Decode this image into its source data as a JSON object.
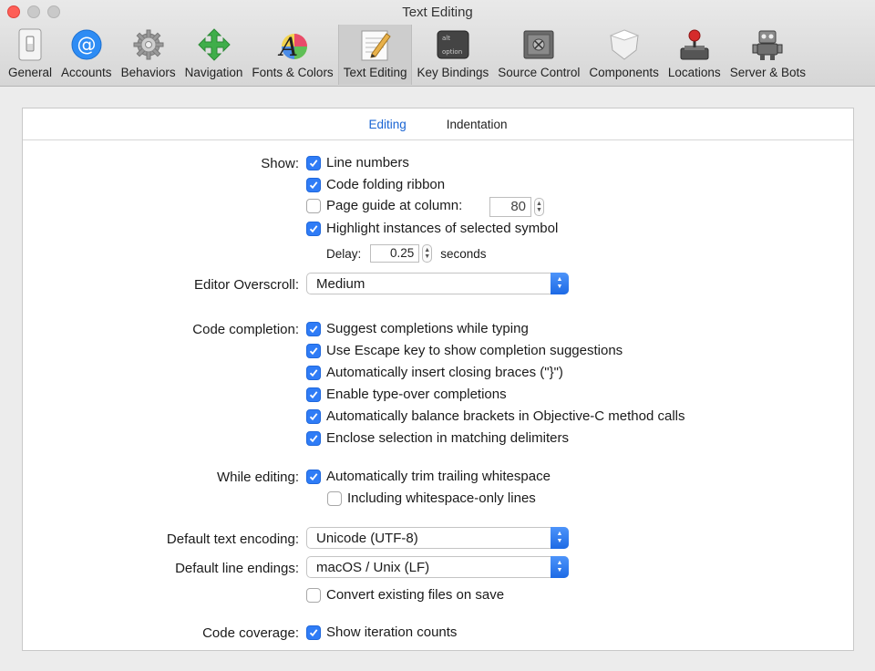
{
  "window": {
    "title": "Text Editing"
  },
  "toolbar": {
    "items": [
      {
        "label": "General",
        "icon": "general-switch-icon"
      },
      {
        "label": "Accounts",
        "icon": "at-sign-icon"
      },
      {
        "label": "Behaviors",
        "icon": "gear-icon"
      },
      {
        "label": "Navigation",
        "icon": "move-arrows-icon"
      },
      {
        "label": "Fonts & Colors",
        "icon": "color-font-icon"
      },
      {
        "label": "Text Editing",
        "icon": "text-edit-pad-icon"
      },
      {
        "label": "Key Bindings",
        "icon": "option-key-icon"
      },
      {
        "label": "Source Control",
        "icon": "safe-vault-icon"
      },
      {
        "label": "Components",
        "icon": "components-shield-icon"
      },
      {
        "label": "Locations",
        "icon": "joystick-icon"
      },
      {
        "label": "Server & Bots",
        "icon": "robot-icon"
      }
    ],
    "active_index": 5
  },
  "tabs": [
    {
      "label": "Editing",
      "active": true
    },
    {
      "label": "Indentation",
      "active": false
    }
  ],
  "show": {
    "label": "Show:",
    "line_numbers": {
      "label": "Line numbers",
      "checked": true
    },
    "code_folding": {
      "label": "Code folding ribbon",
      "checked": true
    },
    "page_guide": {
      "label": "Page guide at column:",
      "checked": false,
      "value": "80"
    },
    "highlight_instances": {
      "label": "Highlight instances of selected symbol",
      "checked": true
    },
    "delay": {
      "label": "Delay:",
      "value": "0.25",
      "unit": "seconds"
    }
  },
  "overscroll": {
    "label": "Editor Overscroll:",
    "value": "Medium"
  },
  "completion": {
    "label": "Code completion:",
    "items": [
      {
        "label": "Suggest completions while typing",
        "checked": true
      },
      {
        "label": "Use Escape key to show completion suggestions",
        "checked": true
      },
      {
        "label": "Automatically insert closing braces (\"}\")",
        "checked": true
      },
      {
        "label": "Enable type-over completions",
        "checked": true
      },
      {
        "label": "Automatically balance brackets in Objective-C method calls",
        "checked": true
      },
      {
        "label": "Enclose selection in matching delimiters",
        "checked": true
      }
    ]
  },
  "while_editing": {
    "label": "While editing:",
    "trim": {
      "label": "Automatically trim trailing whitespace",
      "checked": true
    },
    "whitespace_only": {
      "label": "Including whitespace-only lines",
      "checked": false
    }
  },
  "encoding": {
    "label": "Default text encoding:",
    "value": "Unicode (UTF-8)"
  },
  "line_endings": {
    "label": "Default line endings:",
    "value": "macOS / Unix (LF)"
  },
  "convert": {
    "label": "Convert existing files on save",
    "checked": false
  },
  "coverage": {
    "label": "Code coverage:",
    "iteration": {
      "label": "Show iteration counts",
      "checked": true
    }
  },
  "colors": {
    "accent": "#2f7cf6",
    "tab_active": "#1a64d3",
    "close": "#fe5f57"
  }
}
